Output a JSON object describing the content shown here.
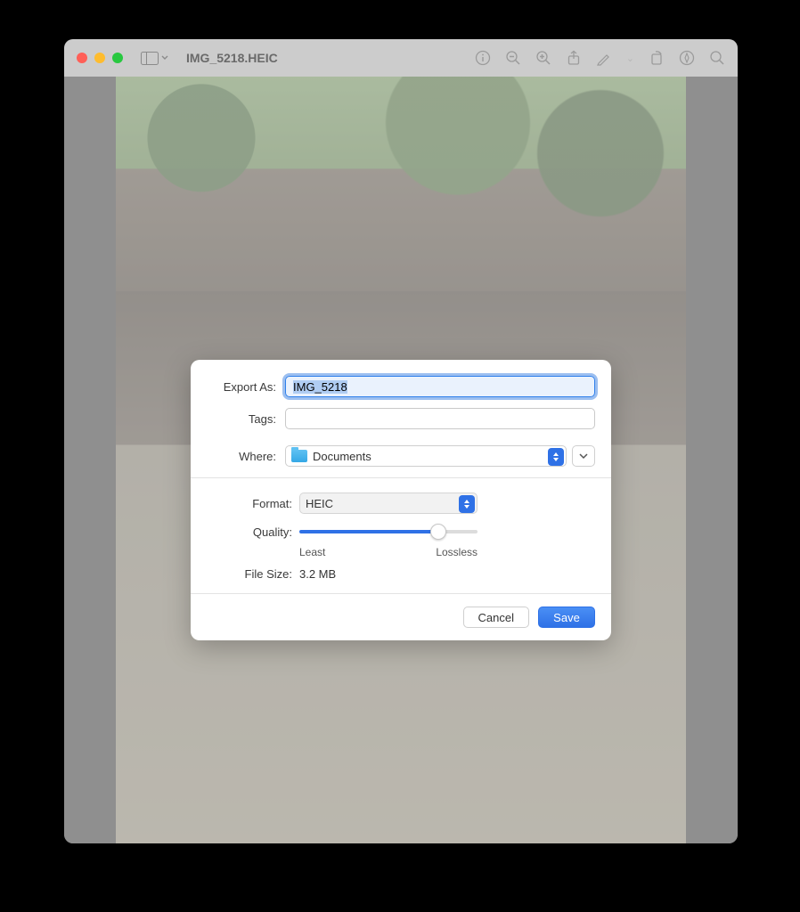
{
  "window": {
    "title": "IMG_5218.HEIC"
  },
  "toolbar_icons": {
    "sidebar": "sidebar-icon",
    "info": "info-icon",
    "zoom_out": "zoom-out-icon",
    "zoom_in": "zoom-in-icon",
    "share": "share-icon",
    "markup": "markup-icon",
    "rotate": "rotate-icon",
    "inspector": "inspector-icon",
    "search": "search-icon"
  },
  "dialog": {
    "export_as": {
      "label": "Export As:",
      "value": "IMG_5218"
    },
    "tags": {
      "label": "Tags:",
      "value": ""
    },
    "where": {
      "label": "Where:",
      "value": "Documents"
    },
    "format": {
      "label": "Format:",
      "value": "HEIC"
    },
    "quality": {
      "label": "Quality:",
      "min_label": "Least",
      "max_label": "Lossless",
      "value_percent": 78
    },
    "filesize": {
      "label": "File Size:",
      "value": "3.2 MB"
    },
    "buttons": {
      "cancel": "Cancel",
      "save": "Save"
    }
  }
}
